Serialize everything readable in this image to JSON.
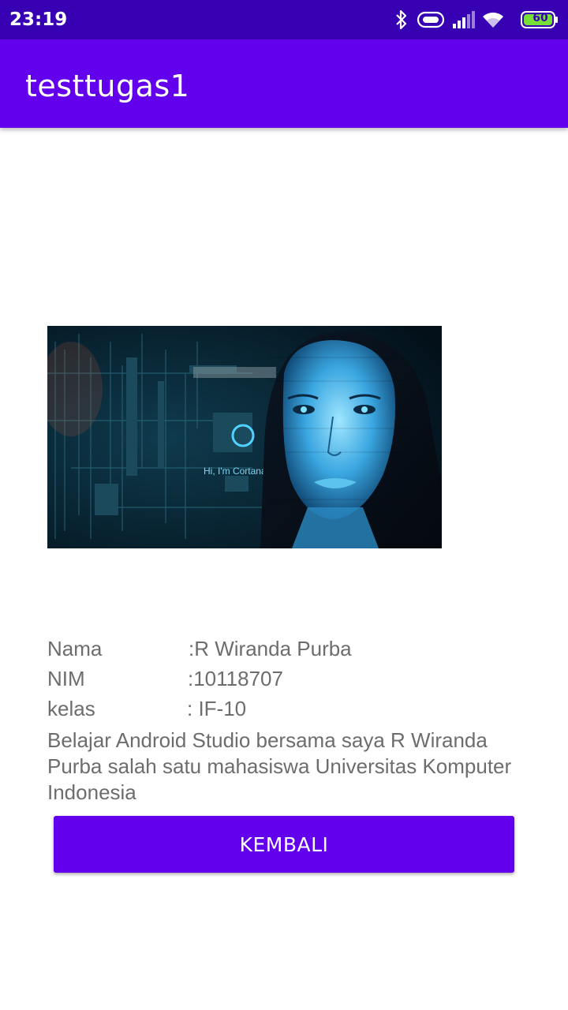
{
  "status_bar": {
    "time": "23:19",
    "battery_level": "60",
    "icons": [
      "bluetooth-icon",
      "alarm-pill-icon",
      "signal-icon",
      "wifi-icon",
      "battery-icon"
    ]
  },
  "app_bar": {
    "title": "testtugas1"
  },
  "image": {
    "caption": "Hi, I'm Cortana."
  },
  "profile": {
    "nama_label": "Nama",
    "nama_value": ":R Wiranda Purba",
    "nim_label": "NIM",
    "nim_value": ":10118707",
    "kelas_label": "kelas",
    "kelas_value": ": IF-10",
    "description": "Belajar Android Studio bersama saya R Wiranda Purba salah satu mahasiswa Universitas Komputer Indonesia"
  },
  "actions": {
    "back_label": "KEMBALI"
  },
  "colors": {
    "status_bar": "#3700b3",
    "primary": "#6200ee",
    "text_secondary": "#6d6d6d"
  }
}
